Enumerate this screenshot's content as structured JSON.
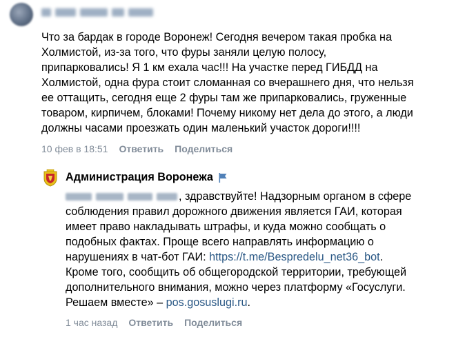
{
  "top_comment": {
    "lines": [
      "Что за бардак в городе Воронеж! Сегодня вечером такая пробка на",
      "Холмистой, из-за того, что фуры заняли целую полосу,",
      "припарковались! Я 1 км ехала час!!! На участке перед ГИБДД на",
      "Холмистой, одна фура стоит сломанная со вчерашнего дня, что нельзя",
      "ее оттащить, сегодня еще 2 фуры там же припарковались, груженные",
      "товаром, кирпичем, блоками! Почему никому нет дела до этого, а люди",
      "должны часами проезжать один маленький участок дороги!!!!"
    ],
    "timestamp": "10 фев в 18:51",
    "reply_label": "Ответить",
    "share_label": "Поделиться"
  },
  "reply": {
    "author": "Администрация Воронежа",
    "greeting": ", здравствуйте! Надзорным органом в сфере",
    "lines": [
      "соблюдения правил дорожного движения является ГАИ, которая",
      "имеет право накладывать штрафы, и куда можно сообщать о",
      "подобных фактах. Проще всего направлять информацию о"
    ],
    "line_with_link_prefix": "нарушениях в чат-бот ГАИ: ",
    "bot_link": "https://t.me/Bespredelu_net36_bot",
    "line_with_link_suffix": ".",
    "lines_after": [
      "Кроме того, сообщить об общегородской территории, требующей",
      "дополнительного внимания, можно через платформу «Госуслуги."
    ],
    "last_line_prefix": "Решаем вместе» – ",
    "portal_link": "pos.gosuslugi.ru",
    "last_line_suffix": ".",
    "timestamp": "1 час назад",
    "reply_label": "Ответить",
    "share_label": "Поделиться"
  },
  "colors": {
    "text": "#000000",
    "meta": "#818c99",
    "link": "#2a5885",
    "flag": "#5181b8"
  }
}
